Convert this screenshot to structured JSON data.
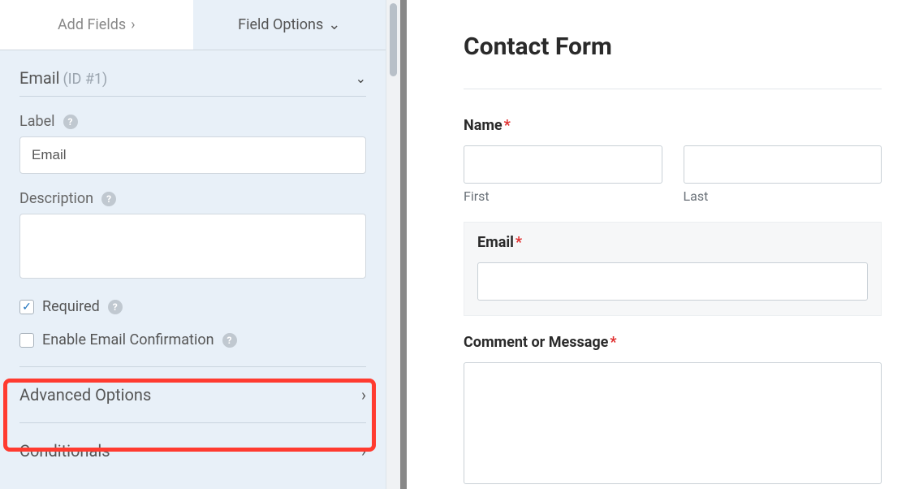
{
  "tabs": {
    "add_fields": "Add Fields",
    "field_options": "Field Options"
  },
  "field_header": {
    "name": "Email",
    "id": "(ID #1)"
  },
  "options": {
    "label_text": "Label",
    "label_value": "Email",
    "description_text": "Description",
    "description_value": "",
    "required_text": "Required",
    "required_checked": true,
    "confirmation_text": "Enable Email Confirmation",
    "confirmation_checked": false
  },
  "sections": {
    "advanced": "Advanced Options",
    "conditionals": "Conditionals"
  },
  "preview": {
    "title": "Contact Form",
    "name_label": "Name",
    "first": "First",
    "last": "Last",
    "email_label": "Email",
    "comment_label": "Comment or Message"
  }
}
